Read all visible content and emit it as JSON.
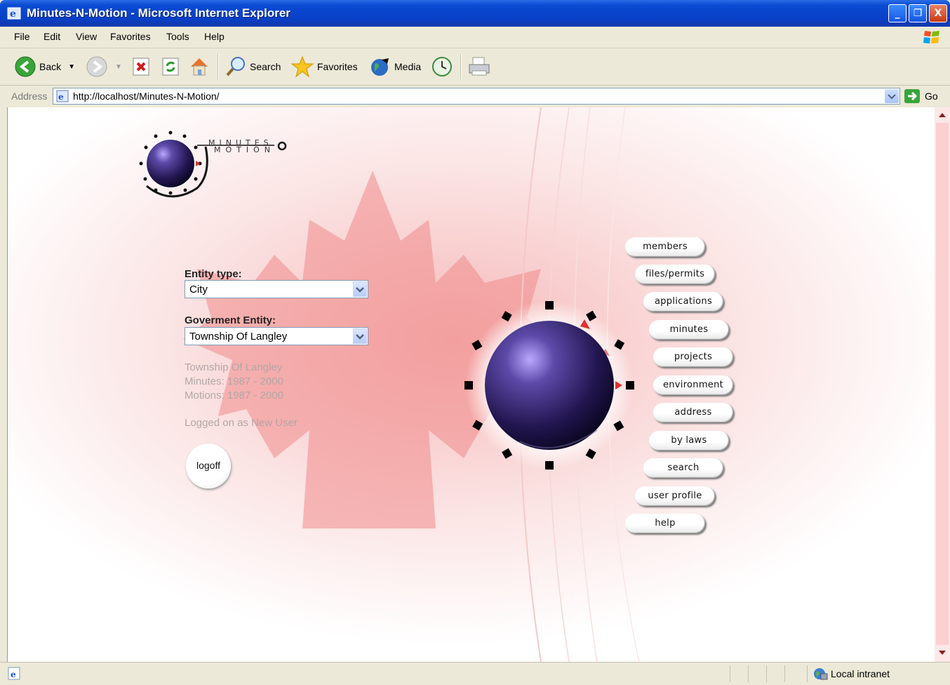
{
  "window": {
    "title": "Minutes-N-Motion - Microsoft Internet Explorer",
    "minimize": "_",
    "restore": "❐",
    "close": "X"
  },
  "menu": [
    "File",
    "Edit",
    "View",
    "Favorites",
    "Tools",
    "Help"
  ],
  "toolbar": {
    "back": "Back",
    "search": "Search",
    "favorites": "Favorites",
    "media": "Media"
  },
  "address": {
    "label": "Address",
    "url": "http://localhost/Minutes-N-Motion/",
    "go": "Go"
  },
  "logo": {
    "line1": "MINUTES",
    "line2": "MOTION"
  },
  "form": {
    "entity_type_label": "Entity type:",
    "entity_type_value": "City",
    "government_entity_label": "Goverment Entity:",
    "government_entity_value": "Township Of Langley"
  },
  "info": {
    "entity_name": "Township Of Langley",
    "minutes": "Minutes: 1987 - 2000",
    "motions": "Motions: 1987 - 2000",
    "logged_on": "Logged on as New User"
  },
  "logoff": "logoff",
  "nav": [
    "members",
    "files/permits",
    "applications",
    "minutes",
    "projects",
    "environment",
    "address",
    "by laws",
    "search",
    "user profile",
    "help"
  ],
  "status": {
    "zone": "Local intranet"
  },
  "colors": {
    "titlebar": "#0a3fc8",
    "sphere": "#2a1f5e",
    "maple": "#f07a7a"
  }
}
